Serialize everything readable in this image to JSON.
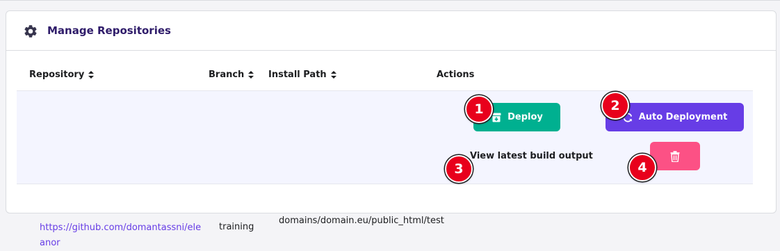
{
  "card": {
    "title": "Manage Repositories",
    "icon": "gear-icon"
  },
  "table": {
    "columns": [
      {
        "label": "Repository",
        "sortable": true
      },
      {
        "label": "Branch",
        "sortable": true
      },
      {
        "label": "Install Path",
        "sortable": true
      },
      {
        "label": "Actions",
        "sortable": false
      }
    ],
    "rows": [
      {
        "repository": "https://github.com/domantassni/eleanor",
        "branch": "training",
        "install_path": "domains/domain.eu/public_html/test"
      }
    ]
  },
  "actions": {
    "deploy_label": "Deploy",
    "auto_deploy_label": "Auto Deployment",
    "build_output_label": "View latest build output",
    "delete_icon": "trash-icon"
  },
  "markers": [
    "1",
    "2",
    "3",
    "4"
  ],
  "colors": {
    "accent": "#673de6",
    "deploy": "#00b090",
    "delete": "#fc5185",
    "marker": "#e8001c"
  }
}
